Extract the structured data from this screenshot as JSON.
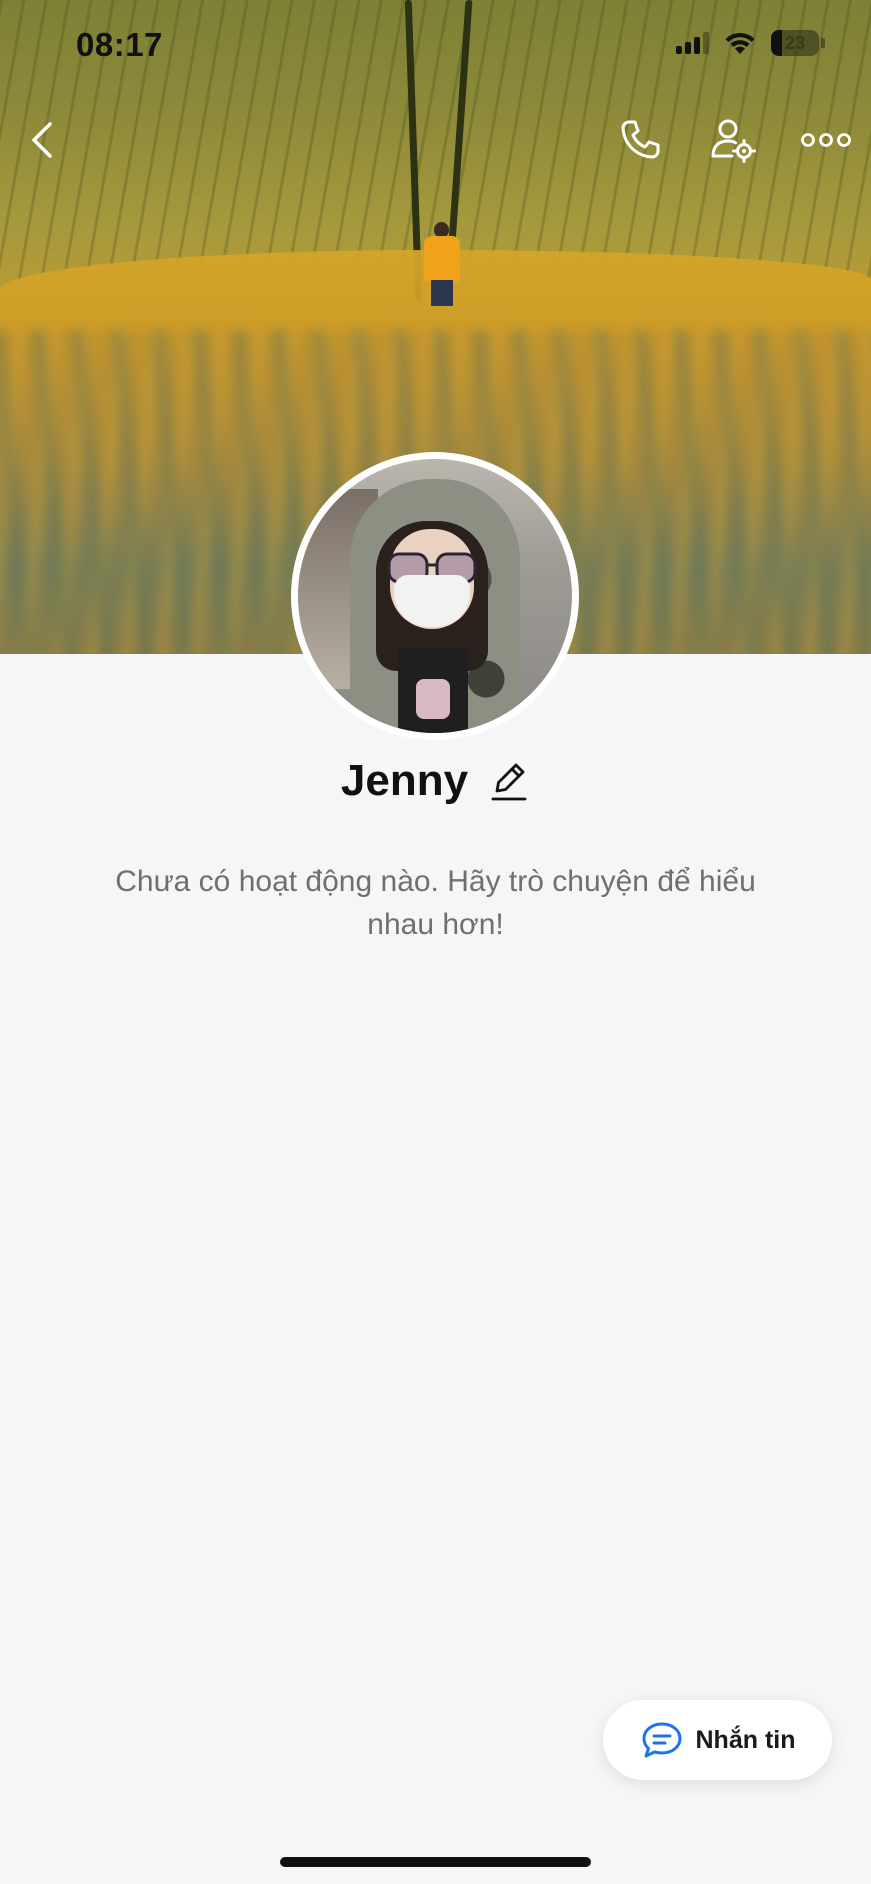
{
  "status_bar": {
    "time": "08:17",
    "battery": "23",
    "battery_level": 0.23,
    "icons": [
      "cellular-signal-icon",
      "wifi-icon",
      "battery-icon"
    ]
  },
  "nav": {
    "back_icon": "chevron-left-icon",
    "call_icon": "phone-icon",
    "profile_settings_icon": "user-settings-icon",
    "more_icon": "more-dots-icon"
  },
  "profile": {
    "name": "Jenny",
    "edit_icon": "pencil-icon"
  },
  "empty_state": {
    "message": "Chưa có hoạt động nào. Hãy trò chuyện để hiểu nhau hơn!"
  },
  "message_button": {
    "label": "Nhắn tin",
    "icon": "chat-bubble-icon",
    "icon_color": "#1a73e8"
  },
  "colors": {
    "background": "#f6f6f6",
    "text_primary": "#111111",
    "text_secondary": "#6f6f6f"
  }
}
